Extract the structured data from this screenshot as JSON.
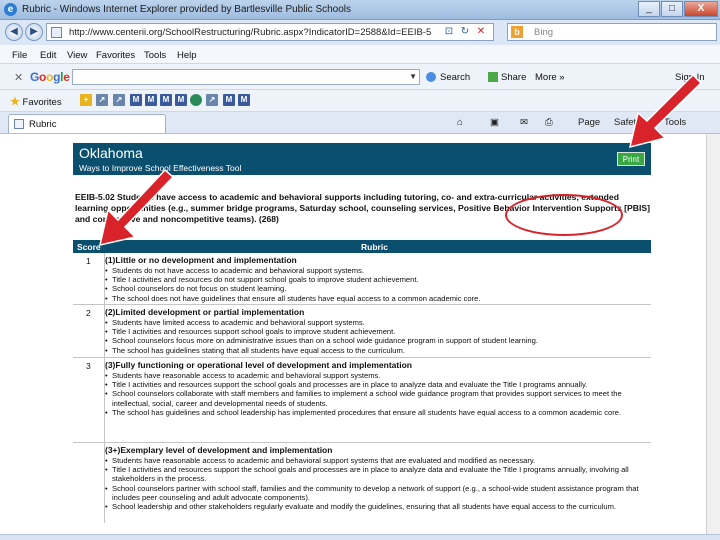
{
  "window": {
    "title": "Rubric - Windows Internet Explorer provided by Bartlesville Public Schools",
    "controls": {
      "minimize": "_",
      "maximize": "□",
      "close": "X"
    }
  },
  "address_bar": {
    "back_icon": "back-arrow-icon",
    "forward_icon": "forward-arrow-icon",
    "url": "http://www.centerii.org/SchoolRestructuring/Rubric.aspx?IndicatorID=2588&Id=EEIB-5",
    "search_placeholder": "Bing"
  },
  "menu": [
    "File",
    "Edit",
    "View",
    "Favorites",
    "Tools",
    "Help"
  ],
  "google_toolbar": {
    "logo_letters": [
      "G",
      "o",
      "o",
      "g",
      "l",
      "e"
    ],
    "logo_colors": [
      "#3b6fd4",
      "#d93025",
      "#f2b50c",
      "#3b6fd4",
      "#1e9e46",
      "#d93025"
    ],
    "search_label": "Search",
    "share_label": "Share",
    "more_label": "More »",
    "signin_label": "Sign In"
  },
  "favorites_bar": {
    "label": "Favorites"
  },
  "tab": {
    "label": "Rubric"
  },
  "command_bar": {
    "page_label": "Page",
    "safety_label": "Safety",
    "tools_label": "Tools"
  },
  "page": {
    "header_title": "Oklahoma",
    "header_subtitle": "Ways to Improve School Effectiveness Tool",
    "print_label": "Print",
    "indicator_text": "EEIB-5.02 Students have access to academic and behavioral supports including tutoring, co- and extra-curricular activities, extended learning opportunities (e.g., summer bridge programs, Saturday school, counseling services, Positive Behavior Intervention Supports [PBIS] and competitive and noncompetitive teams). (268)",
    "table_headers": {
      "score": "Score",
      "rubric": "Rubric"
    },
    "levels": [
      {
        "score": "1",
        "title": "(1)Little or no development and implementation",
        "items": [
          "Students do not have access to academic and behavioral support systems.",
          "Title I activities and resources do not support school goals to improve student achievement.",
          "School counselors do not focus on student learning.",
          "The school does not have guidelines that ensure all students have equal access to a common academic core."
        ]
      },
      {
        "score": "2",
        "title": "(2)Limited development or partial implementation",
        "items": [
          "Students have limited access to academic and behavioral support systems.",
          "Title I activities and resources support school goals to improve student achievement.",
          "School counselors focus more on administrative issues than on a school wide guidance program in support of student learning.",
          "The school has guidelines stating that all students have equal access to the curriculum."
        ]
      },
      {
        "score": "3",
        "title": "(3)Fully functioning or operational level of development and implementation",
        "items": [
          "Students have reasonable access to academic and behavioral support systems.",
          "Title I activities and resources support the school goals and processes are in place to analyze data and evaluate the Title I programs annually.",
          "School counselors collaborate with staff members and families to implement a school wide guidance program that provides support services to meet the intellectual, social, career and developmental needs of students.",
          "The school has guidelines and school leadership has implemented procedures that ensure all students have equal access to a common academic core."
        ]
      },
      {
        "score": "",
        "title": "(3+)Exemplary level of development and implementation",
        "items": [
          "Students have reasonable access to academic and behavioral support systems that are evaluated and modified as necessary.",
          "Title I activities and resources support the school goals and processes are in place to analyze data and evaluate the Title I programs annually, involving all stakeholders in the process.",
          "School counselors partner with school staff, families and the community to develop a network of support (e.g., a school-wide student assistance program that includes peer counseling and adult advocate components).",
          "School leadership and other stakeholders regularly evaluate and modify the guidelines, ensuring that all students have equal access to the curriculum."
        ]
      }
    ]
  },
  "annotations": {
    "arrow_color": "#d8232a",
    "oval_color": "#d8232a"
  }
}
